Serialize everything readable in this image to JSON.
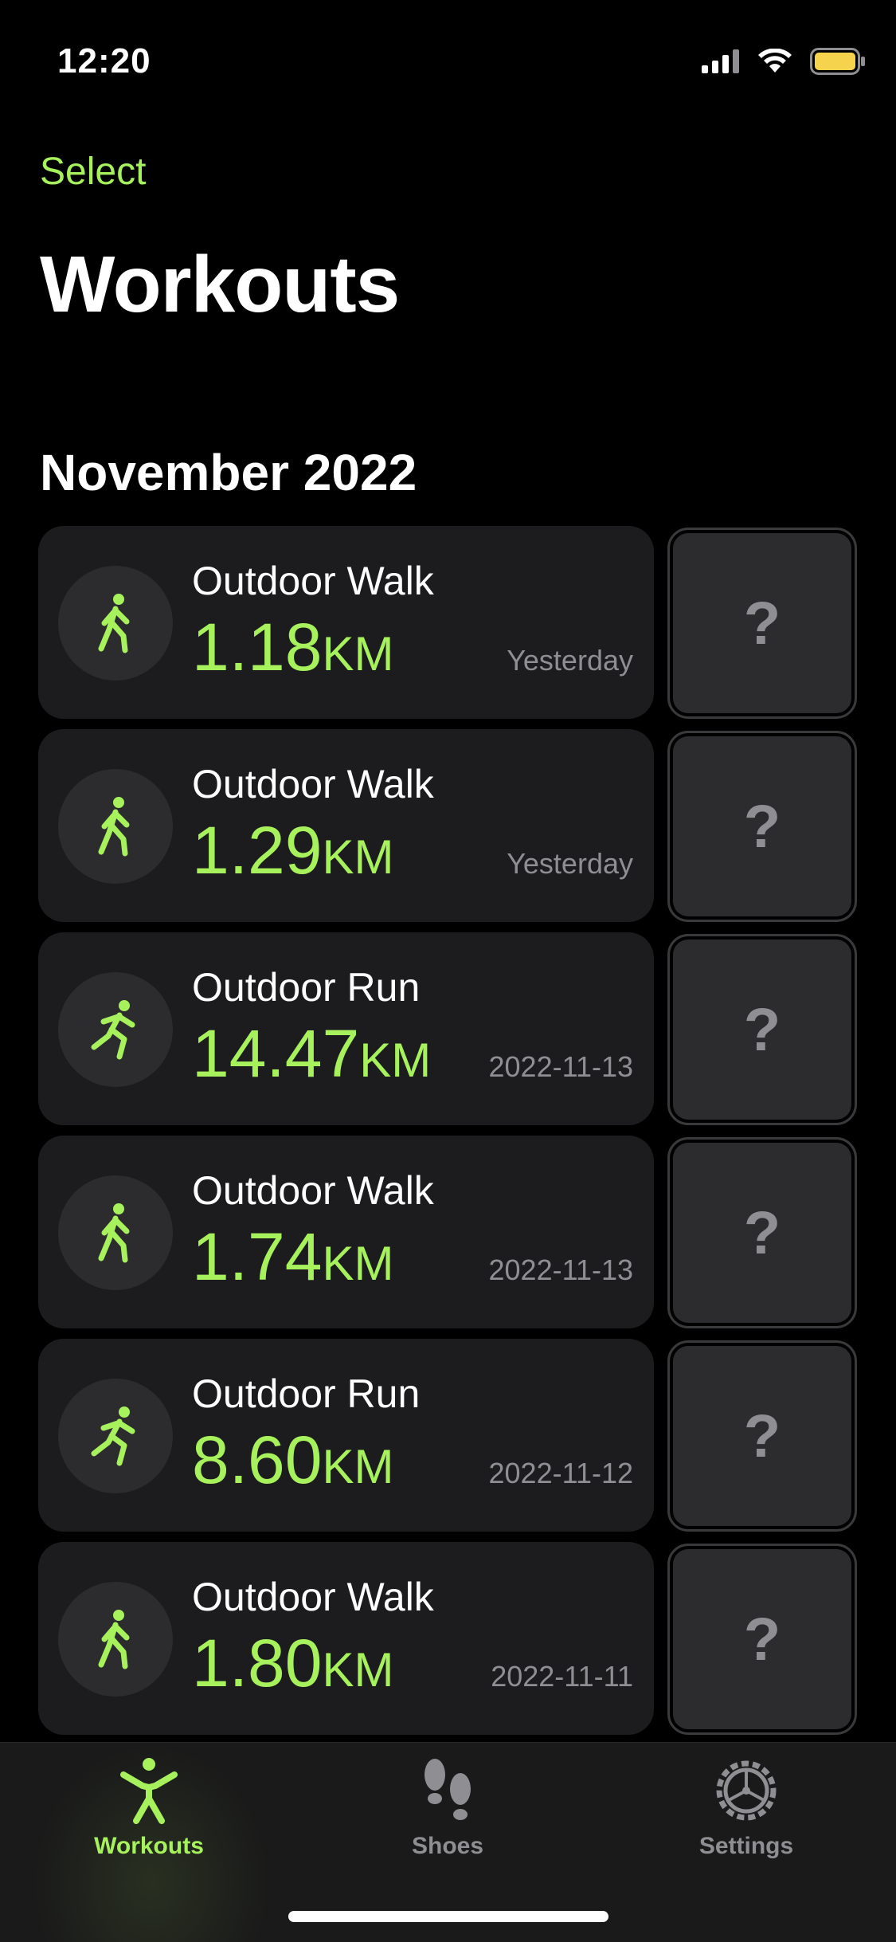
{
  "status_bar": {
    "time": "12:20",
    "icons": [
      "cellular-signal-icon",
      "wifi-icon",
      "battery-icon"
    ],
    "battery_color": "#f5d34c"
  },
  "nav": {
    "select_label": "Select",
    "title": "Workouts"
  },
  "section": {
    "title": "November 2022"
  },
  "accent_color": "#a7f25c",
  "workouts": [
    {
      "name": "Outdoor Walk",
      "distance": "1.18",
      "unit": "KM",
      "date": "Yesterday",
      "icon": "walk-icon",
      "shoe": "?"
    },
    {
      "name": "Outdoor Walk",
      "distance": "1.29",
      "unit": "KM",
      "date": "Yesterday",
      "icon": "walk-icon",
      "shoe": "?"
    },
    {
      "name": "Outdoor Run",
      "distance": "14.47",
      "unit": "KM",
      "date": "2022-11-13",
      "icon": "run-icon",
      "shoe": "?"
    },
    {
      "name": "Outdoor Walk",
      "distance": "1.74",
      "unit": "KM",
      "date": "2022-11-13",
      "icon": "walk-icon",
      "shoe": "?"
    },
    {
      "name": "Outdoor Run",
      "distance": "8.60",
      "unit": "KM",
      "date": "2022-11-12",
      "icon": "run-icon",
      "shoe": "?"
    },
    {
      "name": "Outdoor Walk",
      "distance": "1.80",
      "unit": "KM",
      "date": "2022-11-11",
      "icon": "walk-icon",
      "shoe": "?"
    }
  ],
  "tabs": [
    {
      "label": "Workouts",
      "icon": "person-arms-up-icon",
      "active": true
    },
    {
      "label": "Shoes",
      "icon": "footprints-icon",
      "active": false
    },
    {
      "label": "Settings",
      "icon": "gear-icon",
      "active": false
    }
  ]
}
